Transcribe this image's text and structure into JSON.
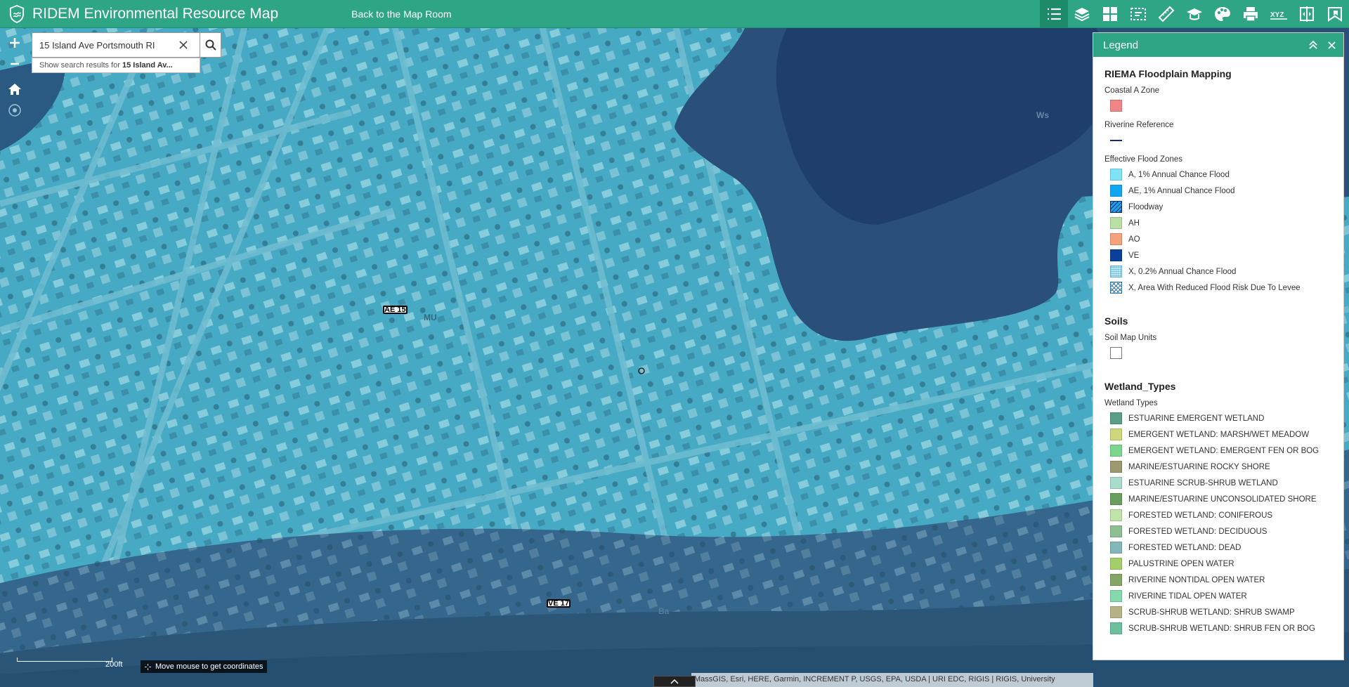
{
  "header": {
    "title": "RIDEM Environmental Resource Map",
    "back_link": "Back to the Map Room",
    "tools": [
      "legend-icon",
      "layers-icon",
      "basemap-gallery-icon",
      "select-icon",
      "measure-icon",
      "education-icon",
      "theme-icon",
      "print-icon",
      "coordinates-icon",
      "swipe-icon",
      "bookmark-icon"
    ]
  },
  "search": {
    "value": "15 Island Ave Portsmouth RI",
    "suggestion_prefix": "Show search results for ",
    "suggestion_term": "15 Island Av..."
  },
  "map": {
    "labels": {
      "ae15": "AE 15",
      "ve17": "VE 17",
      "mu": "MU",
      "ws": "Ws",
      "ba": "Ba"
    },
    "scale_text": "200ft",
    "coords_text": "Move mouse to get coordinates",
    "attribution": "MassGIS, Esri, HERE, Garmin, INCREMENT P, USGS, EPA, USDA | URI EDC, RIGIS | RIGIS, University"
  },
  "legend": {
    "title": "Legend",
    "layers": [
      {
        "name": "RIEMA Floodplain Mapping",
        "groups": [
          {
            "title": "Coastal A Zone",
            "items": [
              {
                "label": "",
                "color": "#f08585",
                "type": "fill"
              }
            ]
          },
          {
            "title": "Riverine Reference",
            "items": [
              {
                "label": "",
                "color": "#1a2a7a",
                "type": "line"
              }
            ]
          },
          {
            "title": "Effective Flood Zones",
            "items": [
              {
                "label": "A, 1% Annual Chance Flood",
                "color": "#7fe3f5",
                "type": "fill"
              },
              {
                "label": "AE, 1% Annual Chance Flood",
                "color": "#12a5f0",
                "type": "fill"
              },
              {
                "label": "Floodway",
                "color": "#1ea0f0",
                "type": "hatch"
              },
              {
                "label": "AH",
                "color": "#b8e0a5",
                "type": "fill"
              },
              {
                "label": "AO",
                "color": "#f5a27a",
                "type": "fill"
              },
              {
                "label": "VE",
                "color": "#0a3f9a",
                "type": "fill"
              },
              {
                "label": "X, 0.2% Annual Chance Flood",
                "color": "#bdeefa",
                "type": "dots"
              },
              {
                "label": "X, Area With Reduced Flood Risk Due To Levee",
                "color": "#ffffff",
                "type": "cross"
              }
            ]
          }
        ]
      },
      {
        "name": "Soils",
        "groups": [
          {
            "title": "Soil Map Units",
            "items": [
              {
                "label": "",
                "color": "#ffffff",
                "type": "outline"
              }
            ]
          }
        ]
      },
      {
        "name": "Wetland_Types",
        "groups": [
          {
            "title": "Wetland Types",
            "items": [
              {
                "label": "ESTUARINE EMERGENT WETLAND",
                "color": "#5a9e86",
                "type": "fill"
              },
              {
                "label": "EMERGENT WETLAND: MARSH/WET MEADOW",
                "color": "#cfd67c",
                "type": "fill"
              },
              {
                "label": "EMERGENT WETLAND: EMERGENT FEN OR BOG",
                "color": "#7cd68e",
                "type": "fill"
              },
              {
                "label": "MARINE/ESTUARINE ROCKY SHORE",
                "color": "#9c9870",
                "type": "fill"
              },
              {
                "label": "ESTUARINE SCRUB-SHRUB WETLAND",
                "color": "#a8dccb",
                "type": "fill"
              },
              {
                "label": "MARINE/ESTUARINE UNCONSOLIDATED SHORE",
                "color": "#6a9e5e",
                "type": "fill"
              },
              {
                "label": "FORESTED WETLAND: CONIFEROUS",
                "color": "#bfe3a9",
                "type": "fill"
              },
              {
                "label": "FORESTED WETLAND: DECIDUOUS",
                "color": "#8dbf92",
                "type": "fill"
              },
              {
                "label": "FORESTED WETLAND: DEAD",
                "color": "#83b7b9",
                "type": "fill"
              },
              {
                "label": "PALUSTRINE OPEN WATER",
                "color": "#a4ce6a",
                "type": "fill"
              },
              {
                "label": "RIVERINE NONTIDAL OPEN WATER",
                "color": "#84a664",
                "type": "fill"
              },
              {
                "label": "RIVERINE TIDAL OPEN WATER",
                "color": "#86d9ad",
                "type": "fill"
              },
              {
                "label": "SCRUB-SHRUB WETLAND: SHRUB SWAMP",
                "color": "#b5b386",
                "type": "fill"
              },
              {
                "label": "SCRUB-SHRUB WETLAND: SHRUB FEN OR BOG",
                "color": "#6dbf9e",
                "type": "fill"
              }
            ]
          }
        ]
      }
    ]
  }
}
